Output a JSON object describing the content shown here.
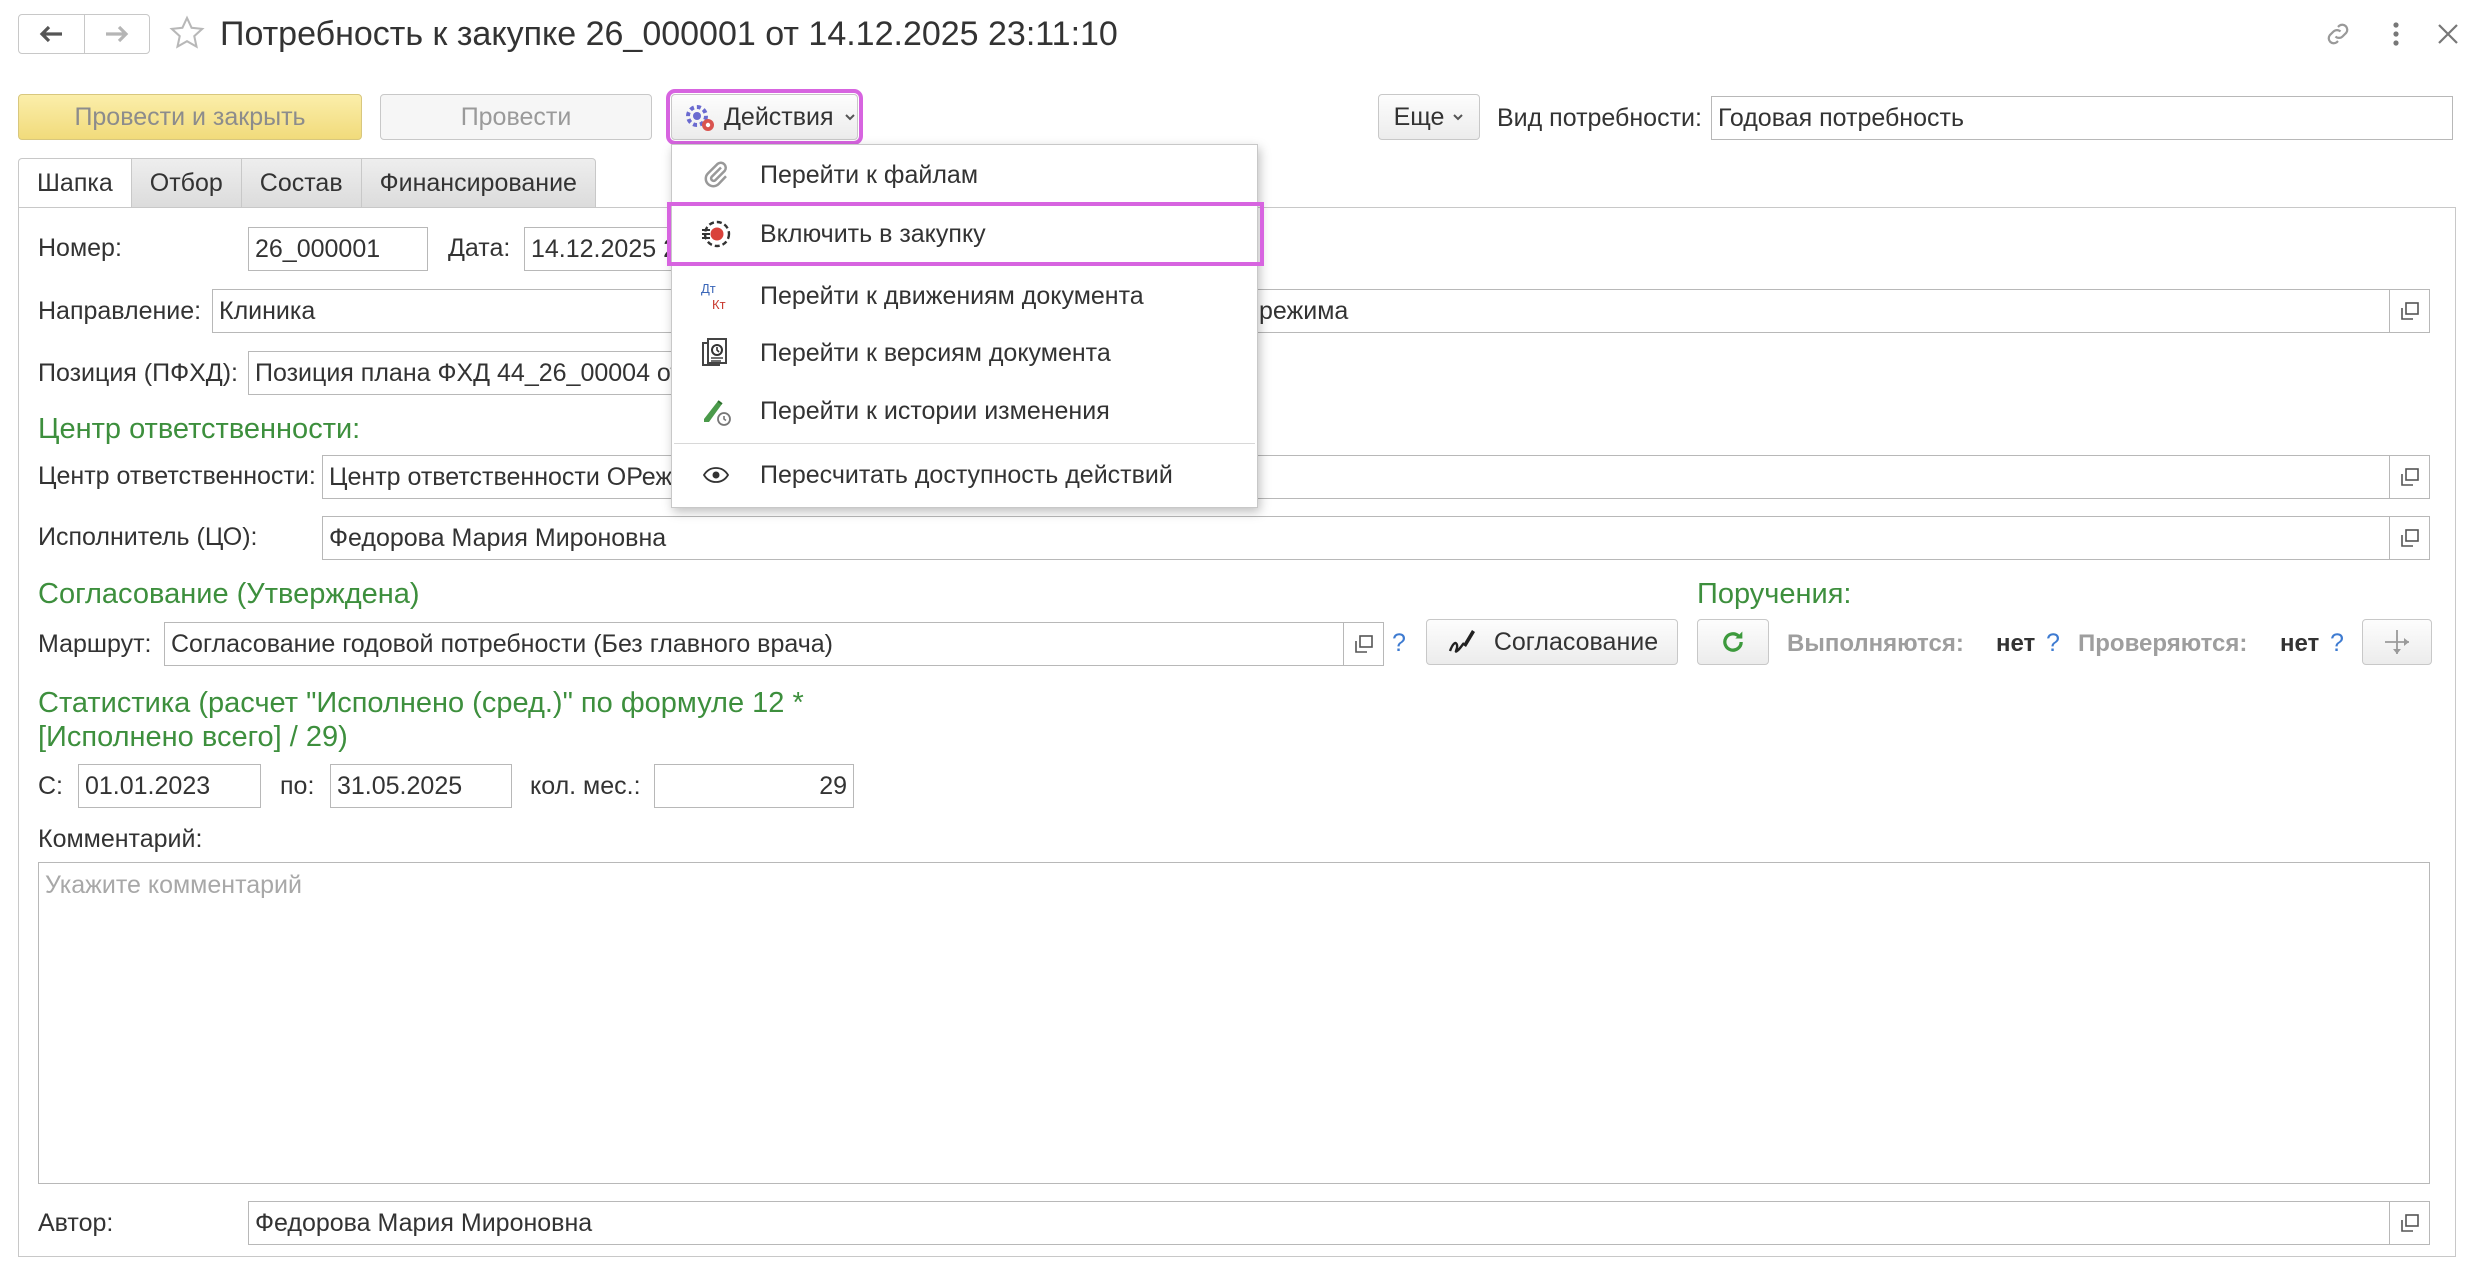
{
  "window": {
    "title": "Потребность к закупке 26_000001 от 14.12.2025 23:11:10"
  },
  "toolbar": {
    "post_close": "Провести и закрыть",
    "post": "Провести",
    "actions": "Действия",
    "more": "Еще",
    "need_type_label": "Вид потребности:",
    "need_type_value": "Годовая потребность"
  },
  "tabs": [
    "Шапка",
    "Отбор",
    "Состав",
    "Финансирование"
  ],
  "form": {
    "number_label": "Номер:",
    "number_value": "26_000001",
    "date_label": "Дата:",
    "date_value": "14.12.2025 2",
    "direction_label": "Направление:",
    "direction_value": "Клиника",
    "direction_value_tail": "режима",
    "position_label": "Позиция (ПФХД):",
    "position_value": "Позиция плана ФХД 44_26_00004 от",
    "rc_section": "Центр ответственности:",
    "rc_label": "Центр ответственности:",
    "rc_value": "Центр ответственности ОРеж",
    "executor_label": "Исполнитель (ЦО):",
    "executor_value": "Федорова Мария Мироновна",
    "approval_section": "Согласование (Утверждена)",
    "route_label": "Маршрут:",
    "route_value": "Согласование годовой потребности (Без главного врача)",
    "qmark": "?",
    "approval_button": "Согласование",
    "orders_section": "Поручения:",
    "executing_label": "Выполняются:",
    "executing_value": "нет",
    "checking_label": "Проверяются:",
    "checking_value": "нет",
    "stats_line1": "Статистика (расчет \"Исполнено (сред.)\" по формуле 12 *",
    "stats_line2": "[Исполнено всего] / 29)",
    "from_label": "С:",
    "from_value": "01.01.2023",
    "to_label": "по:",
    "to_value": "31.05.2025",
    "months_label": "кол. мес.:",
    "months_value": "29",
    "comment_label": "Комментарий:",
    "comment_placeholder": "Укажите комментарий",
    "author_label": "Автор:",
    "author_value": "Федорова Мария Мироновна"
  },
  "menu": {
    "items": [
      {
        "label": "Перейти к файлам",
        "icon": "paperclip-icon"
      },
      {
        "label": "Включить в закупку",
        "icon": "include-procurement-icon"
      },
      {
        "label": "Перейти к движениям документа",
        "icon": "debit-credit-icon"
      },
      {
        "label": "Перейти к версиям документа",
        "icon": "versions-icon"
      },
      {
        "label": "Перейти к истории изменения",
        "icon": "history-icon"
      },
      {
        "label": "Пересчитать доступность действий",
        "icon": "eye-icon"
      }
    ]
  },
  "colors": {
    "section_green": "#3d8f3d",
    "highlight": "#d764e0",
    "question": "#3e7bd1"
  }
}
